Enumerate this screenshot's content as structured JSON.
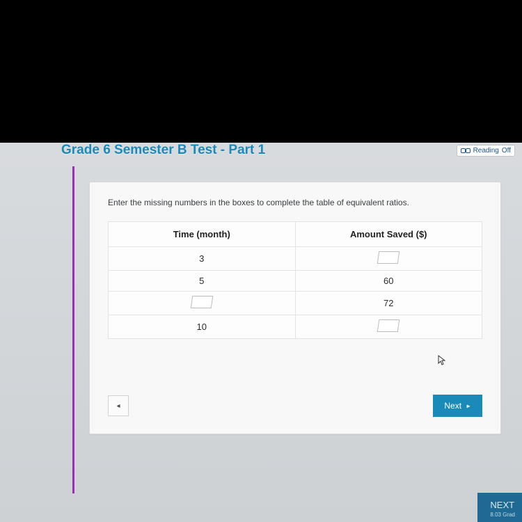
{
  "header": {
    "title": "Grade 6 Semester B Test - Part 1",
    "reading_label": "Reading",
    "reading_state": "Off"
  },
  "question": {
    "prompt": "Enter the missing numbers in the boxes to complete the table of equivalent ratios.",
    "col1_header": "Time (month)",
    "col2_header": "Amount Saved ($)",
    "rows": [
      {
        "time": "3",
        "amount": ""
      },
      {
        "time": "5",
        "amount": "60"
      },
      {
        "time": "",
        "amount": "72"
      },
      {
        "time": "10",
        "amount": ""
      }
    ]
  },
  "nav": {
    "prev_symbol": "◂",
    "next_label": "Next",
    "next_arrow": "►"
  },
  "footer": {
    "next_q_label": "NEXT",
    "next_q_sub": "8.03 Grad"
  }
}
